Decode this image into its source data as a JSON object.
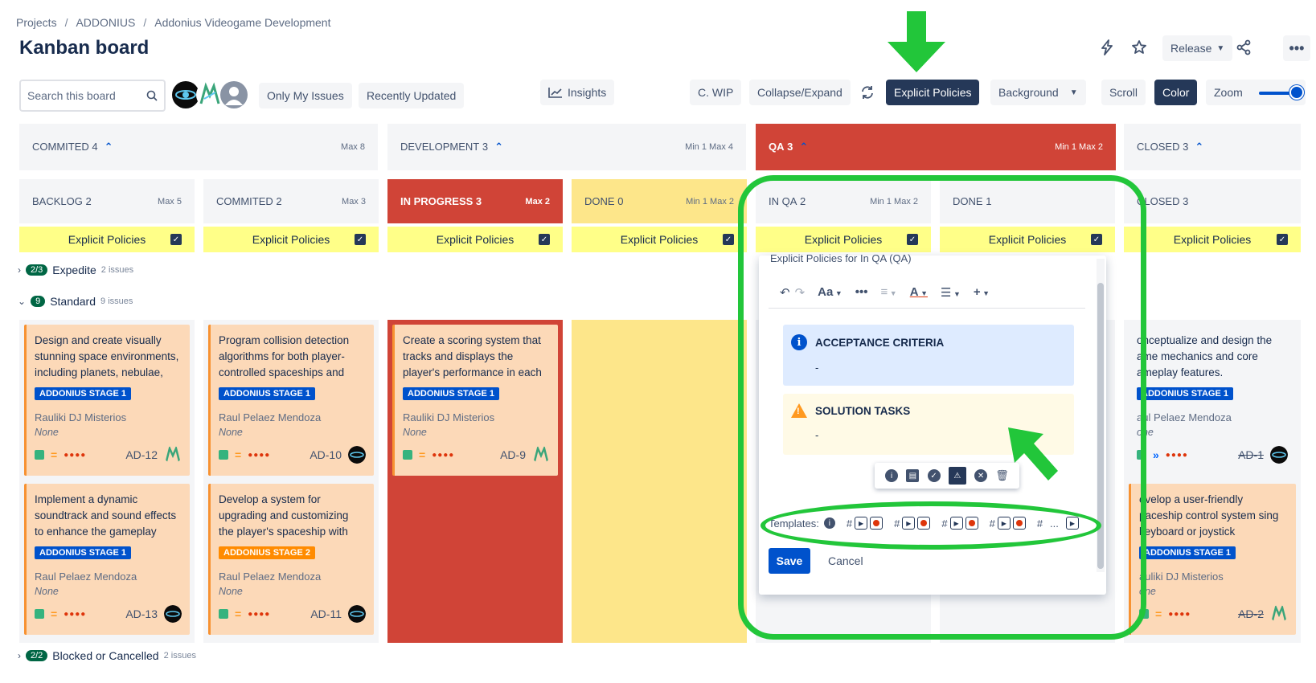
{
  "breadcrumb": [
    "Projects",
    "ADDONIUS",
    "Addonius Videogame Development"
  ],
  "page_title": "Kanban board",
  "header": {
    "release_label": "Release"
  },
  "toolbar": {
    "search_placeholder": "Search this board",
    "only_my_issues": "Only My Issues",
    "recently_updated": "Recently Updated",
    "insights": "Insights",
    "cwip": "C. WIP",
    "collapse_expand": "Collapse/Expand",
    "explicit_policies": "Explicit Policies",
    "background": "Background",
    "scroll": "Scroll",
    "color": "Color",
    "zoom": "Zoom"
  },
  "groups": [
    {
      "name": "COMMITED",
      "count": "4",
      "limit": "Max 8"
    },
    {
      "name": "DEVELOPMENT",
      "count": "3",
      "limit": "Min 1  Max 4"
    },
    {
      "name": "QA",
      "count": "3",
      "limit": "Min 1  Max 2"
    },
    {
      "name": "CLOSED",
      "count": "3",
      "limit": ""
    }
  ],
  "columns": [
    {
      "name": "BACKLOG",
      "count": "2",
      "limit": "Max 5"
    },
    {
      "name": "COMMITED",
      "count": "2",
      "limit": "Max 3"
    },
    {
      "name": "IN PROGRESS",
      "count": "3",
      "limit": "Max 2"
    },
    {
      "name": "DONE",
      "count": "0",
      "limit": "Min 1  Max 2"
    },
    {
      "name": "IN QA",
      "count": "2",
      "limit": "Min 1  Max 2"
    },
    {
      "name": "DONE",
      "count": "1",
      "limit": ""
    },
    {
      "name": "CLOSED",
      "count": "3",
      "limit": ""
    }
  ],
  "policies_label": "Explicit Policies",
  "swimlanes": {
    "expedite": {
      "badge": "2/3",
      "name": "Expedite",
      "count": "2 issues"
    },
    "standard": {
      "badge": "9",
      "name": "Standard",
      "count": "9 issues"
    },
    "blocked": {
      "badge": "2/2",
      "name": "Blocked or Cancelled",
      "count": "2 issues"
    }
  },
  "cards": {
    "c1": {
      "summary": "Design and create visually stunning space environments, including planets, nebulae,",
      "epic": "ADDONIUS STAGE 1",
      "assignee": "Rauliki DJ Misterios",
      "fix": "None",
      "key": "AD-12"
    },
    "c2": {
      "summary": "Program collision detection algorithms for both player-controlled spaceships and",
      "epic": "ADDONIUS STAGE 1",
      "assignee": "Raul Pelaez Mendoza",
      "fix": "None",
      "key": "AD-10"
    },
    "c3": {
      "summary": "Create a scoring system that tracks and displays the player's performance in each",
      "epic": "ADDONIUS STAGE 1",
      "assignee": "Rauliki DJ Misterios",
      "fix": "None",
      "key": "AD-9"
    },
    "c4": {
      "summary": "Implement a dynamic soundtrack and sound effects to enhance the gameplay",
      "epic": "ADDONIUS STAGE 1",
      "assignee": "Raul Pelaez Mendoza",
      "fix": "None",
      "key": "AD-13"
    },
    "c5": {
      "summary": "Develop a system for upgrading and customizing the player's spaceship with",
      "epic": "ADDONIUS STAGE 2",
      "assignee": "Raul Pelaez Mendoza",
      "fix": "None",
      "key": "AD-11"
    },
    "c6": {
      "summary": "onceptualize and design the ame mechanics and core ameplay features.",
      "epic": "ADDONIUS STAGE 1",
      "assignee": "aul Pelaez Mendoza",
      "fix": "one",
      "key": "AD-1"
    },
    "c7": {
      "summary": "evelop a user-friendly paceship control system sing keyboard or joystick",
      "epic": "ADDONIUS STAGE 1",
      "assignee": "auliki DJ Misterios",
      "fix": "one",
      "key": "AD-2"
    }
  },
  "editor": {
    "title": "Explicit Policies for In QA (QA)",
    "font_label": "Aa",
    "panel_info_title": "ACCEPTANCE CRITERIA",
    "panel_info_body": "-",
    "panel_warn_title": "SOLUTION TASKS",
    "panel_warn_body": "-",
    "templates_label": "Templates:",
    "save": "Save",
    "cancel": "Cancel"
  },
  "colors": {
    "accent": "#0052cc",
    "red_column": "#d04437",
    "yellow_column": "#fde68a",
    "card": "#fcd9b8",
    "annotation": "#22c63a"
  }
}
